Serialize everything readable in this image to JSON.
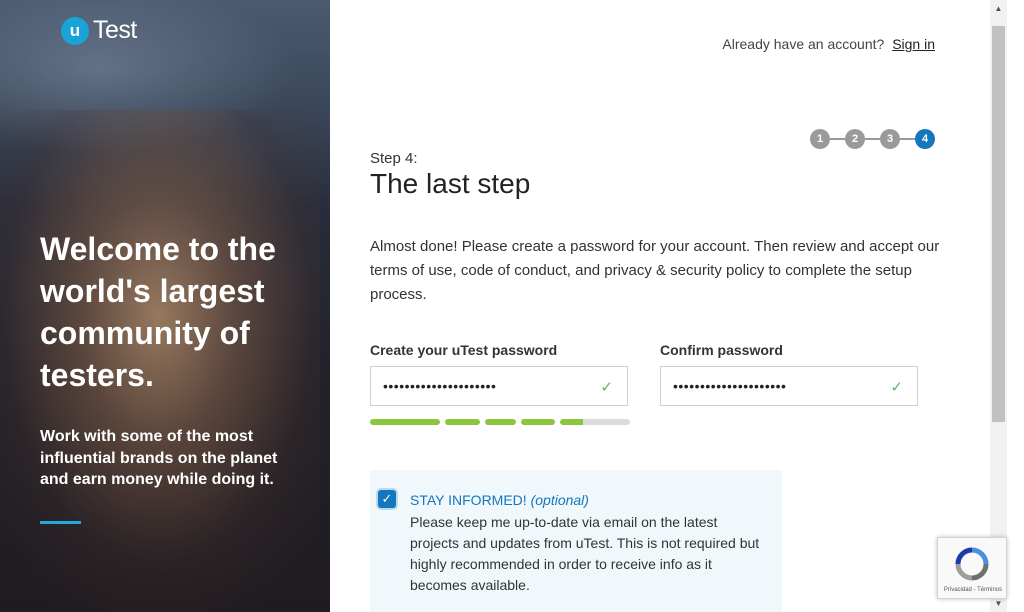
{
  "brand": {
    "logo_letter": "u",
    "logo_text": "Test",
    "accent": "#1aa3d6"
  },
  "hero": {
    "title": "Welcome to the world's largest community of testers.",
    "subtitle": "Work with some of the most influential brands on the planet and earn money while doing it."
  },
  "header": {
    "already_text": "Already have an account?",
    "signin_label": "Sign in"
  },
  "steps": {
    "items": [
      "1",
      "2",
      "3",
      "4"
    ],
    "active": "4"
  },
  "form": {
    "step_label": "Step 4:",
    "title": "The last step",
    "intro": "Almost done! Please create a password for your account. Then review and accept our terms of use, code of conduct, and privacy & security policy to complete the setup process.",
    "password_label": "Create your uTest password",
    "password_value": "•••••••••••••••••••••",
    "confirm_label": "Confirm password",
    "confirm_value": "•••••••••••••••••••••",
    "strength_fraction": 0.82,
    "strength_color": "#8cc63f"
  },
  "optin": {
    "title": "STAY INFORMED!",
    "optional": "(optional)",
    "body": "Please keep me up-to-date via email on the latest projects and updates from uTest. This is not required but highly recommended in order to receive info as it becomes available.",
    "checked": true
  },
  "recaptcha": {
    "terms": "Privacidad - Términos"
  }
}
